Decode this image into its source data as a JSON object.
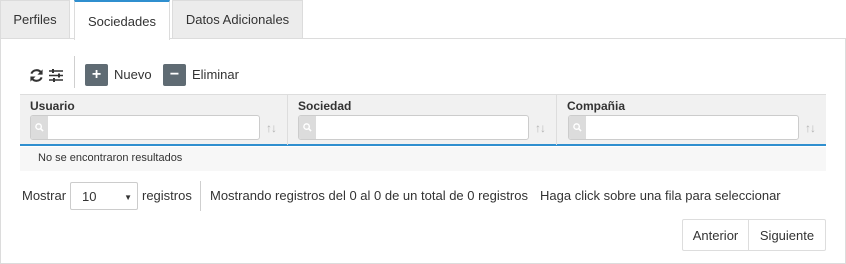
{
  "tabs": [
    {
      "label": "Perfiles"
    },
    {
      "label": "Sociedades",
      "active": true
    },
    {
      "label": "Datos Adicionales"
    }
  ],
  "toolbar": {
    "refresh_icon": "refresh-icon",
    "settings_icon": "sliders-icon",
    "new_label": "Nuevo",
    "delete_label": "Eliminar"
  },
  "table": {
    "columns": [
      {
        "label": "Usuario",
        "search_value": ""
      },
      {
        "label": "Sociedad",
        "search_value": ""
      },
      {
        "label": "Compañia",
        "search_value": ""
      }
    ],
    "empty_message": "No se encontraron resultados"
  },
  "footer": {
    "show_label": "Mostrar",
    "page_size": "10",
    "records_label": "registros",
    "info": "Mostrando registros del 0 al 0 de un total de 0 registros",
    "hint": "Haga click sobre una fila para seleccionar",
    "prev_label": "Anterior",
    "next_label": "Siguiente"
  },
  "colors": {
    "accent": "#2f8fcf",
    "button_bg": "#5f6b73"
  }
}
